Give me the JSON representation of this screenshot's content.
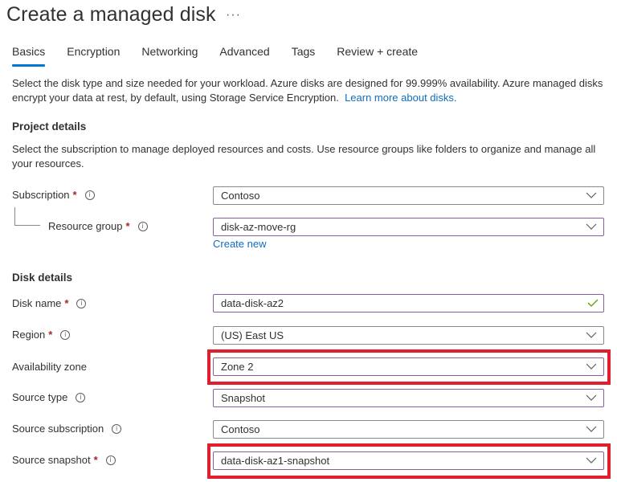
{
  "header": {
    "title": "Create a managed disk",
    "more_label": "···"
  },
  "tabs": [
    {
      "label": "Basics",
      "active": true
    },
    {
      "label": "Encryption",
      "active": false
    },
    {
      "label": "Networking",
      "active": false
    },
    {
      "label": "Advanced",
      "active": false
    },
    {
      "label": "Tags",
      "active": false
    },
    {
      "label": "Review + create",
      "active": false
    }
  ],
  "intro": {
    "text": "Select the disk type and size needed for your workload. Azure disks are designed for 99.999% availability. Azure managed disks encrypt your data at rest, by default, using Storage Service Encryption.",
    "link": "Learn more about disks."
  },
  "project": {
    "heading": "Project details",
    "description": "Select the subscription to manage deployed resources and costs. Use resource groups like folders to organize and manage all your resources.",
    "subscription": {
      "label": "Subscription",
      "required": "*",
      "value": "Contoso"
    },
    "resource_group": {
      "label": "Resource group",
      "required": "*",
      "value": "disk-az-move-rg",
      "create_new": "Create new"
    }
  },
  "disk": {
    "heading": "Disk details",
    "disk_name": {
      "label": "Disk name",
      "required": "*",
      "value": "data-disk-az2",
      "valid": true
    },
    "region": {
      "label": "Region",
      "required": "*",
      "value": "(US) East US"
    },
    "availability_zone": {
      "label": "Availability zone",
      "value": "Zone 2",
      "highlighted": true
    },
    "source_type": {
      "label": "Source type",
      "value": "Snapshot"
    },
    "source_subscription": {
      "label": "Source subscription",
      "value": "Contoso"
    },
    "source_snapshot": {
      "label": "Source snapshot",
      "required": "*",
      "value": "data-disk-az1-snapshot",
      "highlighted": true
    }
  },
  "icons": {
    "info": "i"
  },
  "colors": {
    "accent": "#0078d4",
    "link": "#0f6cbd",
    "required": "#a4262c",
    "highlight": "#e01e2d",
    "valid": "#57a300"
  }
}
